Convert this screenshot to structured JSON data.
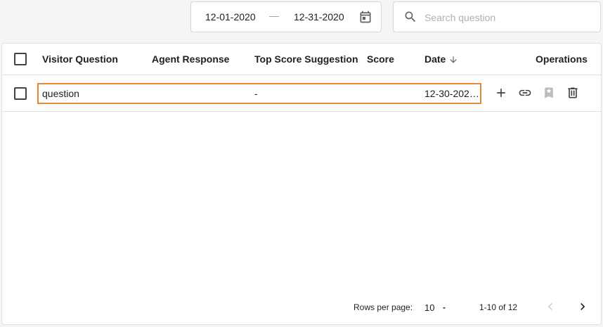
{
  "filters": {
    "date_start": "12-01-2020",
    "date_separator": "—",
    "date_end": "12-31-2020",
    "search_placeholder": "Search question",
    "search_value": ""
  },
  "table": {
    "columns": {
      "visitor_question": "Visitor Question",
      "agent_response": "Agent Response",
      "top_score_suggestion": "Top Score Suggestion",
      "score": "Score",
      "date": "Date",
      "operations": "Operations"
    },
    "sort": {
      "column": "date",
      "direction": "desc",
      "icon": "arrow-down-icon"
    },
    "rows": [
      {
        "checked": false,
        "visitor_question": "question",
        "agent_response": "",
        "top_score_suggestion": "-",
        "score": "",
        "date": "12-30-202…",
        "highlighted": true,
        "operations": [
          "add-icon",
          "link-icon",
          "bookmark-icon",
          "delete-icon"
        ]
      }
    ]
  },
  "pagination": {
    "rows_per_page_label": "Rows per page:",
    "rows_per_page_value": "10",
    "range_text": "1-10 of 12",
    "prev_enabled": false,
    "next_enabled": true
  },
  "colors": {
    "highlight_border": "#e8893a",
    "icon_dark": "#424242",
    "icon_muted": "#bdbdbd",
    "border": "#e0e0e0"
  }
}
